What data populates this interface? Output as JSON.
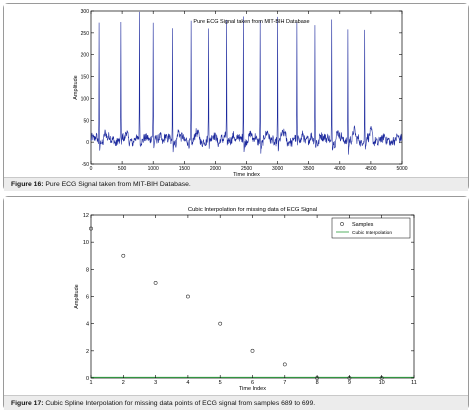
{
  "figures": [
    {
      "caption_label": "Figure 16:",
      "caption_text": " Pure ECG Signal taken from MIT-BIH Database."
    },
    {
      "caption_label": "Figure 17:",
      "caption_text": " Cubic Spline Interpolation for missing data points of ECG signal from samples 689 to 699."
    }
  ],
  "chart_data": [
    {
      "type": "line",
      "title": "Pure ECG Signal taken from MIT-BIH Database",
      "xlabel": "Time index",
      "ylabel": "Amplitude",
      "xlim": [
        0,
        5000
      ],
      "ylim": [
        -50,
        300
      ],
      "xticks": [
        0,
        500,
        1000,
        1500,
        2000,
        2500,
        3000,
        3500,
        4000,
        4500,
        5000
      ],
      "yticks": [
        -50,
        0,
        50,
        100,
        150,
        200,
        250,
        300
      ],
      "grid": false,
      "line_color": "#1d2a9e",
      "series": [
        {
          "r_peak_times": [
            130,
            480,
            780,
            1000,
            1310,
            1610,
            1890,
            2180,
            2450,
            2720,
            3000,
            3310,
            3600,
            3870,
            4130,
            4400
          ],
          "r_peak_heights": [
            270,
            280,
            295,
            265,
            273,
            272,
            262,
            270,
            290,
            272,
            280,
            270,
            265,
            285,
            272,
            258
          ],
          "baseline": 5,
          "noise_amplitude": 10
        }
      ]
    },
    {
      "type": "scatter",
      "title": "Cubic Interpolation for missing data of ECG Signal",
      "xlabel": "Time Index",
      "ylabel": "Amplitude",
      "xlim": [
        1,
        11
      ],
      "ylim": [
        0,
        12
      ],
      "xticks": [
        1,
        2,
        3,
        4,
        5,
        6,
        7,
        8,
        9,
        10,
        11
      ],
      "yticks": [
        0,
        2,
        4,
        6,
        8,
        10,
        12
      ],
      "grid": false,
      "legend_position": "top-right",
      "series": [
        {
          "name": "Samples",
          "marker": "circle",
          "x": [
            1,
            2,
            3,
            4,
            5,
            6,
            7,
            8,
            9,
            10
          ],
          "y": [
            11,
            9,
            7,
            6,
            4,
            2,
            1,
            0,
            0,
            0
          ],
          "color": "#333333"
        },
        {
          "name": "Cubic Interpolation",
          "line": true,
          "x": [
            1,
            11
          ],
          "y": [
            0,
            0
          ],
          "color": "#2e9e3e"
        }
      ]
    }
  ]
}
